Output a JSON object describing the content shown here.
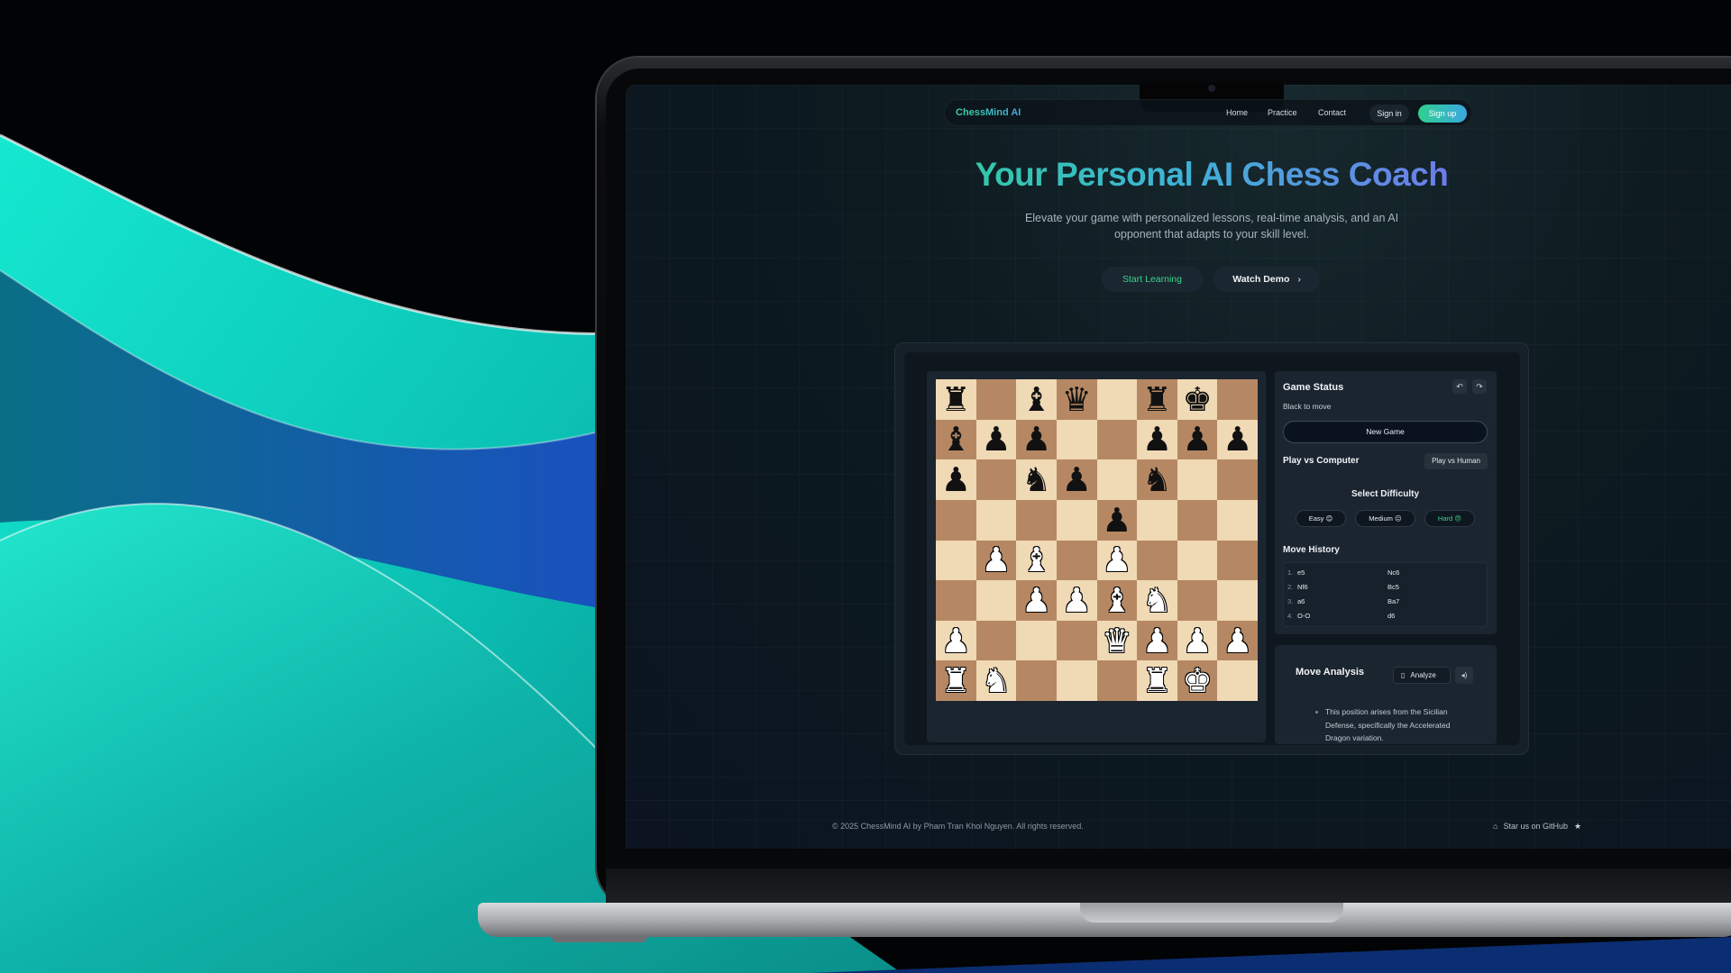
{
  "nav": {
    "brand": "ChessMind AI",
    "links": [
      "Home",
      "Practice",
      "Contact"
    ],
    "sign_in": "Sign in",
    "sign_up": "Sign up"
  },
  "hero": {
    "title": "Your Personal AI Chess Coach",
    "subtitle": "Elevate your game with personalized lessons, real-time analysis, and an AI opponent that adapts to your skill level.",
    "start_learning": "Start Learning",
    "watch_demo": "Watch Demo",
    "watch_demo_icon": "chevron-right-icon"
  },
  "board": {
    "ranks": [
      [
        "br",
        "",
        "bb",
        "bq",
        "",
        "br",
        "bk",
        ""
      ],
      [
        "bb",
        "bp",
        "bp",
        "",
        "",
        "bp",
        "bp",
        "bp"
      ],
      [
        "bp",
        "",
        "bn",
        "bp",
        "",
        "bn",
        "",
        ""
      ],
      [
        "",
        "",
        "",
        "",
        "bp",
        "",
        "",
        ""
      ],
      [
        "",
        "wp",
        "wb",
        "",
        "wp",
        "",
        "",
        ""
      ],
      [
        "",
        "",
        "wp",
        "wp",
        "wb",
        "wn",
        "",
        ""
      ],
      [
        "wp",
        "",
        "",
        "",
        "wq",
        "wp",
        "wp",
        "wp"
      ],
      [
        "wr",
        "wn",
        "",
        "",
        "",
        "wr",
        "wk",
        ""
      ]
    ],
    "colors": {
      "light": "#f0d9b5",
      "dark": "#b58863"
    }
  },
  "status": {
    "title": "Game Status",
    "turn": "Black to move",
    "undo_icon": "undo-icon",
    "redo_icon": "redo-icon",
    "new_game": "New Game",
    "mode": "Play vs Computer",
    "mode_toggle": "Play vs Human",
    "difficulty_title": "Select Difficulty",
    "difficulties": [
      "Easy 😊",
      "Medium 😐",
      "Hard 😠"
    ],
    "selected_difficulty": "Hard"
  },
  "history": {
    "title": "Move History",
    "moves": [
      {
        "num": "1.",
        "white": "e5",
        "black": "Nc6"
      },
      {
        "num": "2.",
        "white": "Nf6",
        "black": "Bc5"
      },
      {
        "num": "3.",
        "white": "a6",
        "black": "Ba7"
      },
      {
        "num": "4.",
        "white": "O-O",
        "black": "d6"
      }
    ]
  },
  "analysis": {
    "title": "Move Analysis",
    "analyze": "Analyze",
    "analyze_icon": "book-icon",
    "speak_icon": "speaker-icon",
    "text": "This position arises from the Sicilian Defense, specifically the Accelerated Dragon variation."
  },
  "footer": {
    "copyright": "© 2025 ChessMind AI by Pham Tran Khoi Nguyen. All rights reserved.",
    "github": "Star us on GitHub"
  }
}
